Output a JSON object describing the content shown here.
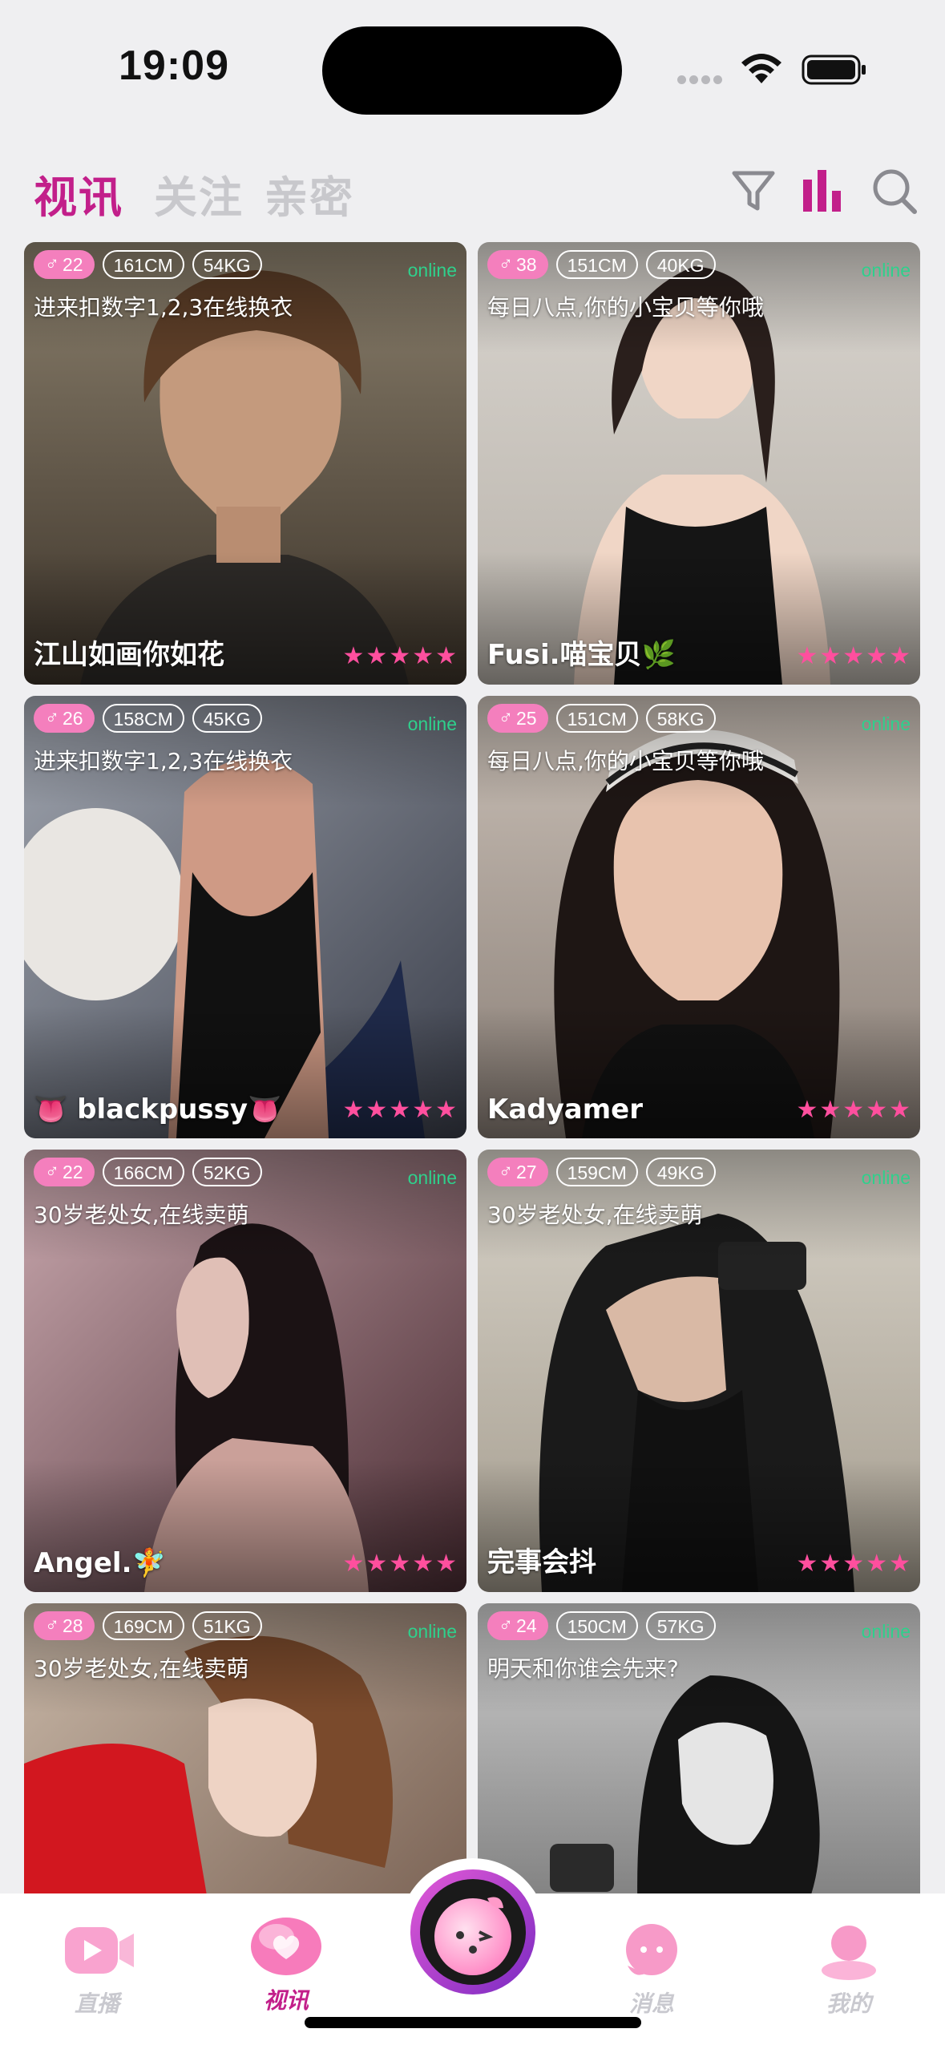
{
  "status_bar": {
    "time": "19:09"
  },
  "top_tabs": [
    {
      "label": "视讯",
      "active": true
    },
    {
      "label": "关注",
      "active": false
    },
    {
      "label": "亲密",
      "active": false
    }
  ],
  "icons": {
    "filter": "filter-icon",
    "rank": "rank-icon",
    "search": "search-icon"
  },
  "colors": {
    "accent": "#c21f8a",
    "online": "#2fd08c",
    "gender_badge": "#f47fbd",
    "star": "#ff4f9e"
  },
  "cards": [
    {
      "gender_symbol": "♂",
      "age": "22",
      "height": "161CM",
      "weight": "54KG",
      "status": "online",
      "intro": "进来扣数字1,2,3在线换衣",
      "nickname": "江山如画你如花",
      "rating": 5
    },
    {
      "gender_symbol": "♂",
      "age": "38",
      "height": "151CM",
      "weight": "40KG",
      "status": "online",
      "intro": "每日八点,你的小宝贝等你哦",
      "nickname": "Fusi.喵宝贝🌿",
      "rating": 5
    },
    {
      "gender_symbol": "♂",
      "age": "26",
      "height": "158CM",
      "weight": "45KG",
      "status": "online",
      "intro": "进来扣数字1,2,3在线换衣",
      "nickname": "👅 blackpussy👅",
      "rating": 5
    },
    {
      "gender_symbol": "♂",
      "age": "25",
      "height": "151CM",
      "weight": "58KG",
      "status": "online",
      "intro": "每日八点,你的小宝贝等你哦",
      "nickname": "Kadyamer",
      "rating": 5
    },
    {
      "gender_symbol": "♂",
      "age": "22",
      "height": "166CM",
      "weight": "52KG",
      "status": "online",
      "intro": "30岁老处女,在线卖萌",
      "nickname": "Angel.🧚",
      "rating": 5
    },
    {
      "gender_symbol": "♂",
      "age": "27",
      "height": "159CM",
      "weight": "49KG",
      "status": "online",
      "intro": "30岁老处女,在线卖萌",
      "nickname": "完事会抖",
      "rating": 5
    },
    {
      "gender_symbol": "♂",
      "age": "28",
      "height": "169CM",
      "weight": "51KG",
      "status": "online",
      "intro": "30岁老处女,在线卖萌",
      "nickname": "",
      "rating": 0
    },
    {
      "gender_symbol": "♂",
      "age": "24",
      "height": "150CM",
      "weight": "57KG",
      "status": "online",
      "intro": "明天和你谁会先来?",
      "nickname": "",
      "rating": 0
    }
  ],
  "bottom_nav": [
    {
      "label": "直播",
      "icon": "live-video-icon",
      "active": false
    },
    {
      "label": "视讯",
      "icon": "video-chat-icon",
      "active": true
    },
    {
      "label": "",
      "icon": "peach-mascot-icon",
      "active": false
    },
    {
      "label": "消息",
      "icon": "message-icon",
      "active": false
    },
    {
      "label": "我的",
      "icon": "profile-icon",
      "active": false
    }
  ]
}
